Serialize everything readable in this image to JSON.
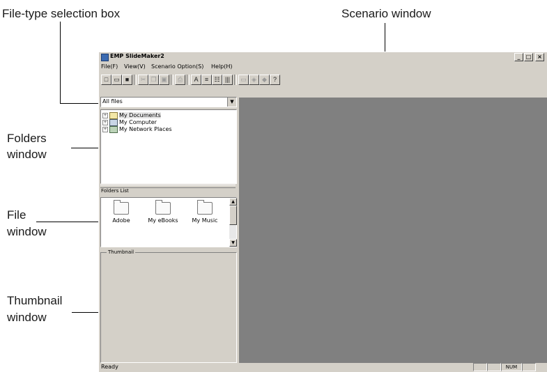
{
  "callouts": {
    "file_type_selection_box": "File-type selection box",
    "scenario_window": "Scenario window",
    "folders_window_1": "Folders",
    "folders_window_2": "window",
    "file_window_1": "File",
    "file_window_2": "window",
    "thumbnail_window_1": "Thumbnail",
    "thumbnail_window_2": "window"
  },
  "window": {
    "title": "EMP SlideMaker2",
    "minimize": "_",
    "maximize": "□",
    "close": "×"
  },
  "menu": [
    "File(F)",
    "View(V)",
    "Scenario Option(S)",
    "Help(H)"
  ],
  "toolbar_icons": [
    "new-icon",
    "open-icon",
    "save-icon",
    "cut-icon",
    "copy-icon",
    "paste-icon",
    "print-icon",
    "text-mode-icon",
    "list-mode-icon",
    "detail-view-icon",
    "column-view-icon",
    "monitor-icon",
    "play-icon",
    "send-icon",
    "help-icon"
  ],
  "file_type": {
    "value": "All files"
  },
  "folders_tree": [
    {
      "label": "My Documents",
      "icon": "documents-folder-icon"
    },
    {
      "label": "My Computer",
      "icon": "computer-icon"
    },
    {
      "label": "My Network Places",
      "icon": "network-places-icon"
    }
  ],
  "folders_list_label": "Folders List",
  "files": [
    {
      "label": "Adobe"
    },
    {
      "label": "My eBooks"
    },
    {
      "label": "My Music"
    }
  ],
  "thumbnail_label": "Thumbnail",
  "status": {
    "text": "Ready",
    "num": "NUM"
  },
  "colors": {
    "window_face": "#d4d0c8",
    "scenario_bg": "#808080",
    "list_bg": "#ffffff"
  }
}
